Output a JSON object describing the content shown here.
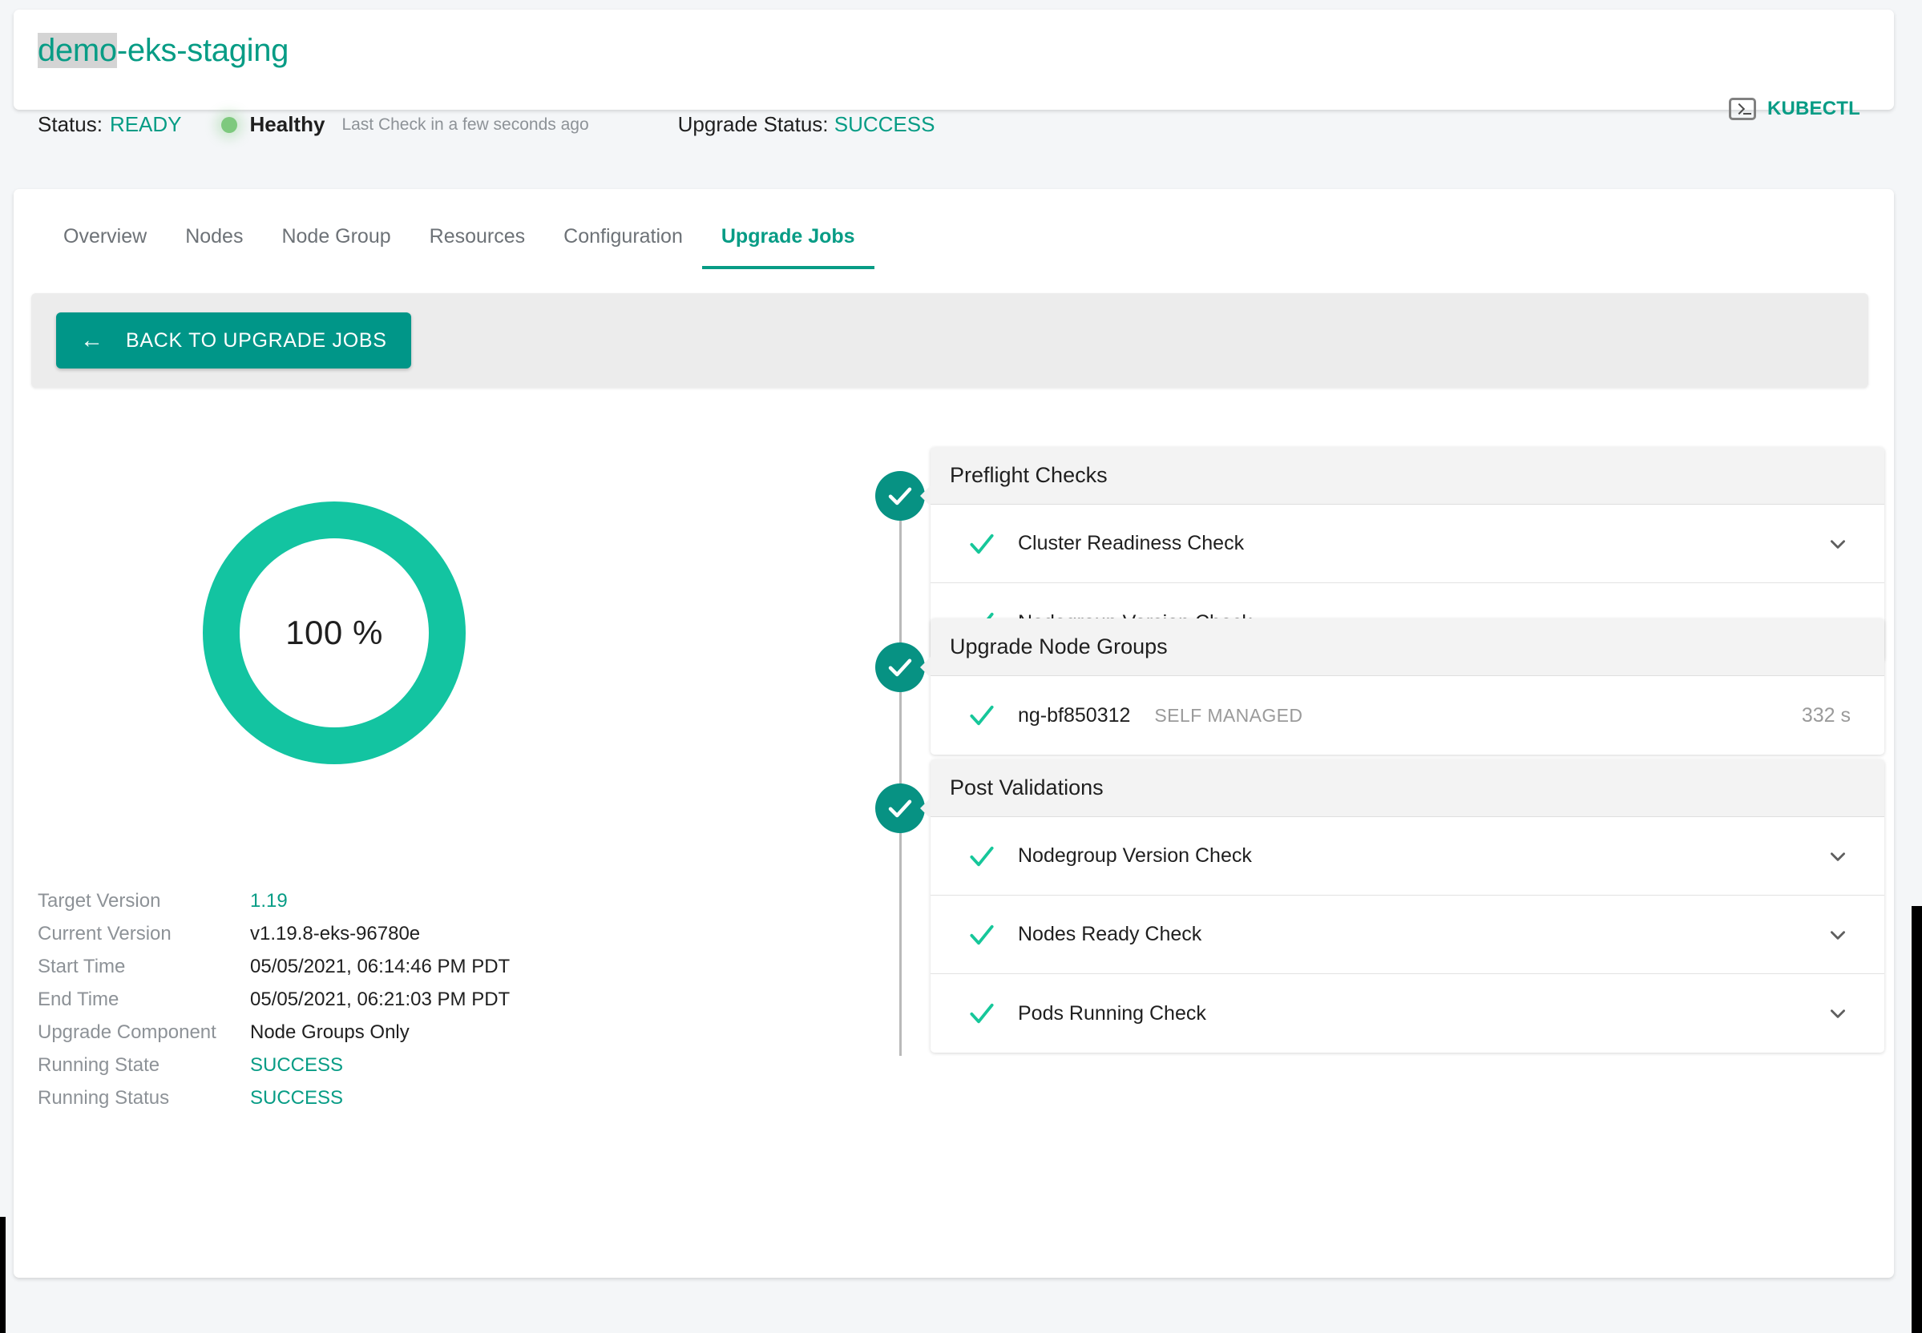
{
  "header": {
    "cluster_name_selected": "demo",
    "cluster_name_rest": "-eks-staging",
    "status_label": "Status:",
    "status_value": "READY",
    "health_text": "Healthy",
    "last_check": "Last Check in a few seconds ago",
    "upgrade_status_label": "Upgrade Status:",
    "upgrade_status_value": "SUCCESS",
    "kubectl_label": "KUBECTL"
  },
  "tabs": [
    {
      "label": "Overview",
      "active": false
    },
    {
      "label": "Nodes",
      "active": false
    },
    {
      "label": "Node Group",
      "active": false
    },
    {
      "label": "Resources",
      "active": false
    },
    {
      "label": "Configuration",
      "active": false
    },
    {
      "label": "Upgrade Jobs",
      "active": true
    }
  ],
  "toolbar": {
    "back_label": "BACK TO UPGRADE JOBS",
    "back_arrow": "←"
  },
  "progress": {
    "percent_label": "100 %",
    "percent": 100
  },
  "details": [
    {
      "label": "Target Version",
      "value": "1.19",
      "accent": true
    },
    {
      "label": "Current Version",
      "value": "v1.19.8-eks-96780e",
      "accent": false
    },
    {
      "label": "Start Time",
      "value": "05/05/2021, 06:14:46 PM PDT",
      "accent": false
    },
    {
      "label": "End Time",
      "value": "05/05/2021, 06:21:03 PM PDT",
      "accent": false
    },
    {
      "label": "Upgrade Component",
      "value": "Node Groups Only",
      "accent": false
    },
    {
      "label": "Running State",
      "value": "SUCCESS",
      "accent": true
    },
    {
      "label": "Running Status",
      "value": "SUCCESS",
      "accent": true
    }
  ],
  "stages": [
    {
      "title": "Preflight Checks",
      "rows": [
        {
          "label": "Cluster Readiness Check",
          "sub": "",
          "time": "",
          "expander": true
        },
        {
          "label": "Nodegroup Version Check",
          "sub": "",
          "time": "",
          "expander": true
        }
      ]
    },
    {
      "title": "Upgrade Node Groups",
      "rows": [
        {
          "label": "ng-bf850312",
          "sub": "SELF MANAGED",
          "time": "332 s",
          "expander": false
        }
      ]
    },
    {
      "title": "Post Validations",
      "rows": [
        {
          "label": "Nodegroup Version Check",
          "sub": "",
          "time": "",
          "expander": true
        },
        {
          "label": "Nodes Ready Check",
          "sub": "",
          "time": "",
          "expander": true
        },
        {
          "label": "Pods Running Check",
          "sub": "",
          "time": "",
          "expander": true
        }
      ]
    }
  ],
  "colors": {
    "accent_teal": "#079c85",
    "badge_teal": "#079283",
    "donut_teal": "#13c4a1",
    "check_teal": "#16c79a",
    "button_teal": "#009688",
    "health_green": "#7ec97e",
    "muted": "#8d9297"
  }
}
